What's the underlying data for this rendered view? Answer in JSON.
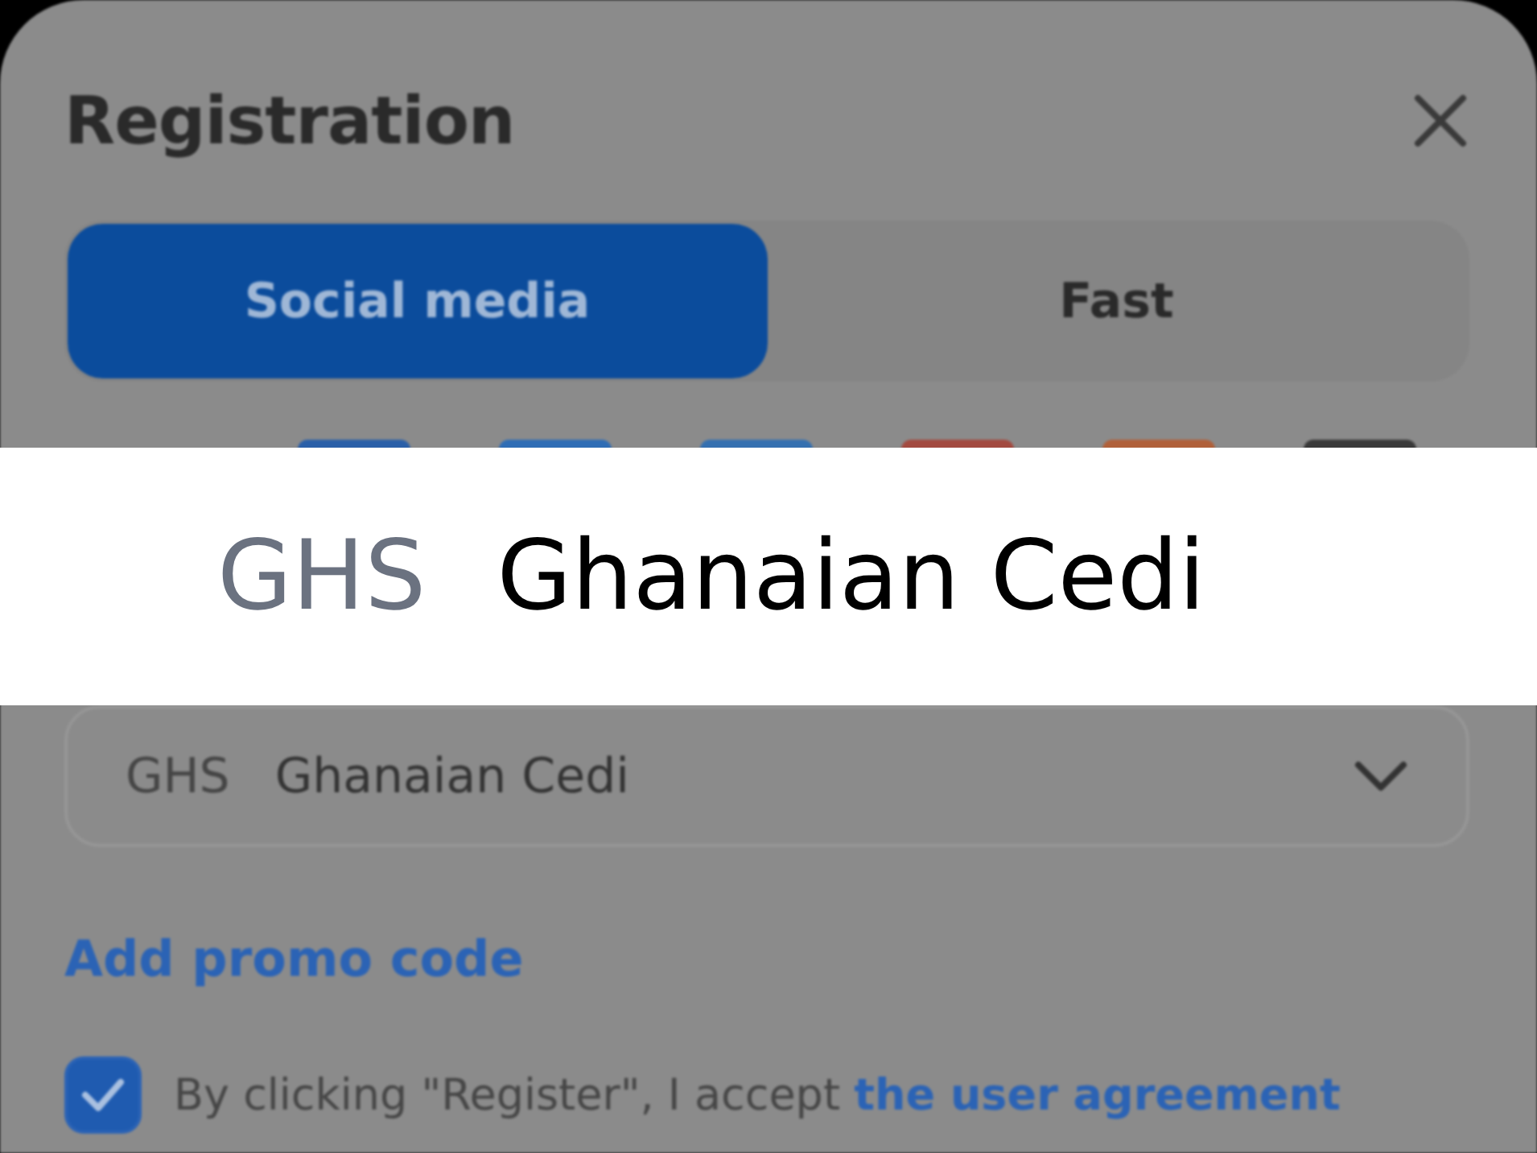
{
  "modal": {
    "title": "Registration",
    "tabs": [
      {
        "label": "Social media",
        "selected": true
      },
      {
        "label": "Fast",
        "selected": false
      }
    ],
    "social_buttons": [
      {
        "color": "#2a5fa8"
      },
      {
        "color": "#2f6db5"
      },
      {
        "color": "#3570b0"
      },
      {
        "color": "#a34a40"
      },
      {
        "color": "#b0603a"
      },
      {
        "color": "#3a3a3a"
      }
    ],
    "currency": {
      "code": "GHS",
      "name": "Ghanaian Cedi"
    },
    "promo_link": "Add promo code",
    "agreement": {
      "checked": true,
      "text": "By clicking \"Register\", I accept",
      "link": "the user agreement"
    }
  },
  "highlight": {
    "code": "GHS",
    "name": "Ghanaian Cedi"
  }
}
